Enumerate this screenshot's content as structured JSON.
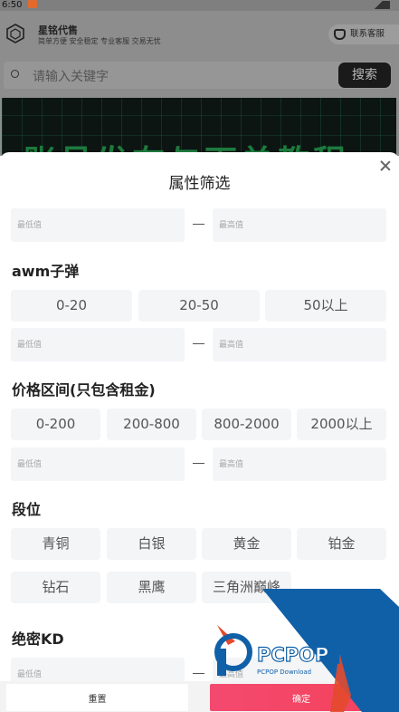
{
  "status_bar": {
    "time": "6:50"
  },
  "background": {
    "app_title": "星铭代售",
    "slogan": "简单方便 安全稳定 专业客服 交易无忧",
    "contact_label": "联系客服",
    "search_placeholder": "请输入关键字",
    "search_button": "搜索",
    "banner_text": "账号发布与下单教程"
  },
  "sheet": {
    "title": "属性筛选",
    "min_placeholder": "最低值",
    "max_placeholder": "最高值",
    "sections": [
      {
        "title": "awm子弹",
        "options": [
          "0-20",
          "20-50",
          "50以上"
        ]
      },
      {
        "title": "价格区间(只包含租金)",
        "options": [
          "0-200",
          "200-800",
          "800-2000",
          "2000以上"
        ]
      },
      {
        "title": "段位",
        "options": [
          "青铜",
          "白银",
          "黄金",
          "铂金",
          "钻石",
          "黑鹰",
          "三角洲巅峰"
        ]
      },
      {
        "title": "绝密KD",
        "options": []
      }
    ]
  },
  "footer": {
    "reset_label": "重置",
    "confirm_label": "确定"
  },
  "watermark": {
    "brand": "PCPOP下载",
    "sub": "PCPOP Download"
  },
  "colors": {
    "confirm_start": "#f4496f",
    "confirm_end": "#f3425b",
    "chip_bg": "#f4f5f7",
    "watermark_blue": "#1060a8"
  }
}
